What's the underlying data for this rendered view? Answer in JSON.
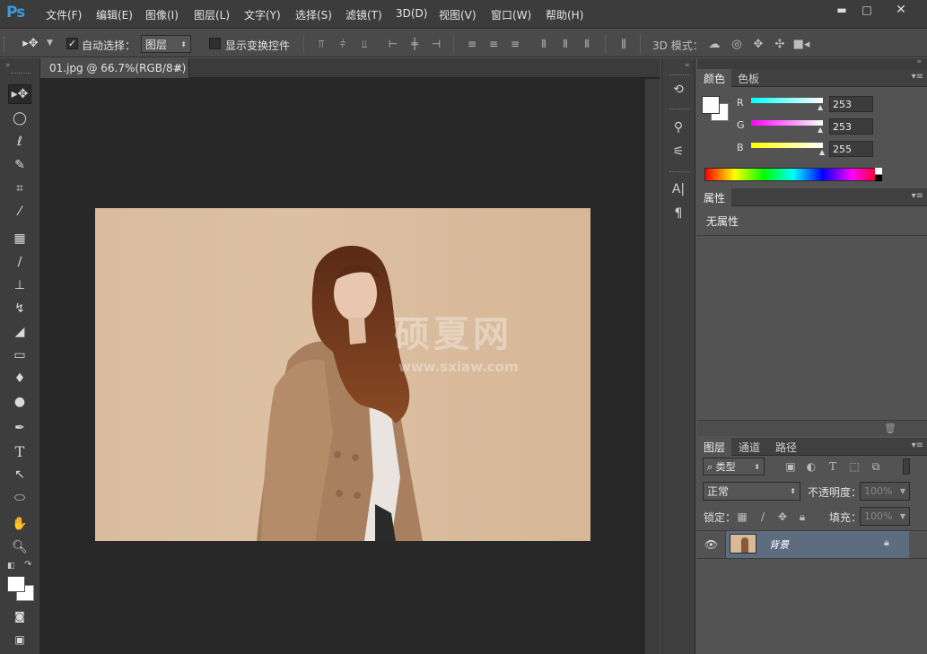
{
  "app": {
    "logo": "Ps"
  },
  "menu": {
    "items": [
      "文件(F)",
      "编辑(E)",
      "图像(I)",
      "图层(L)",
      "文字(Y)",
      "选择(S)",
      "滤镜(T)",
      "3D(D)",
      "视图(V)",
      "窗口(W)",
      "帮助(H)"
    ]
  },
  "window": {
    "minimize": "▬",
    "restore": "□",
    "close": "✕"
  },
  "options": {
    "auto_select_label": "自动选择：",
    "auto_select_value": "图层",
    "show_transform_label": "显示变换控件",
    "mode_3d_label": "3D 模式："
  },
  "document": {
    "tab_title": "01.jpg @ 66.7%(RGB/8#)",
    "tab_close": "×",
    "watermark_cn": "硕夏网",
    "watermark_url": "www.sxiaw.com"
  },
  "color_panel": {
    "tabs": [
      "颜色",
      "色板"
    ],
    "channels": [
      {
        "label": "R",
        "value": "253",
        "gradient": "#35e7f0"
      },
      {
        "label": "G",
        "value": "253",
        "gradient": "#f03bf0"
      },
      {
        "label": "B",
        "value": "255",
        "gradient": "#f0f038"
      }
    ]
  },
  "properties_panel": {
    "tab": "属性",
    "empty_text": "无属性"
  },
  "layers_panel": {
    "tabs": [
      "图层",
      "通道",
      "路径"
    ],
    "filter_label": "类型",
    "blend_mode": "正常",
    "opacity_label": "不透明度：",
    "opacity_value": "100%",
    "lock_label": "锁定：",
    "fill_label": "填充：",
    "fill_value": "100%",
    "layers": [
      {
        "name": "背景"
      }
    ]
  },
  "colors": {
    "accent": "#3a9ad9",
    "canvas_bg": "#d9bc9e",
    "workspace": "#282828",
    "selected_layer": "#5e6c80"
  }
}
